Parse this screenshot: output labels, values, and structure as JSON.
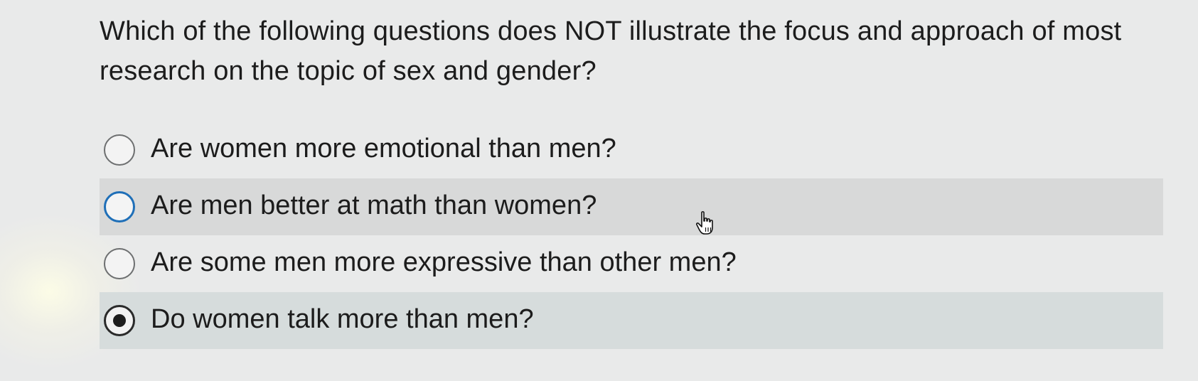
{
  "question": {
    "text": "Which of the following questions does NOT illustrate the focus and approach of most research on the topic of sex and gender?"
  },
  "options": [
    {
      "label": "Are women more emotional than men?",
      "selected": false,
      "hovered": false
    },
    {
      "label": "Are men better at math than women?",
      "selected": false,
      "hovered": true
    },
    {
      "label": "Are some men more expressive than other men?",
      "selected": false,
      "hovered": false
    },
    {
      "label": "Do women talk more than men?",
      "selected": true,
      "hovered": false
    }
  ],
  "cursor": {
    "icon": "hand-pointer-icon"
  },
  "colors": {
    "background": "#e9eaea",
    "hover_row": "#d8d9d9",
    "selected_row": "#d6dcdc",
    "focus_ring": "#1f6fb8"
  }
}
